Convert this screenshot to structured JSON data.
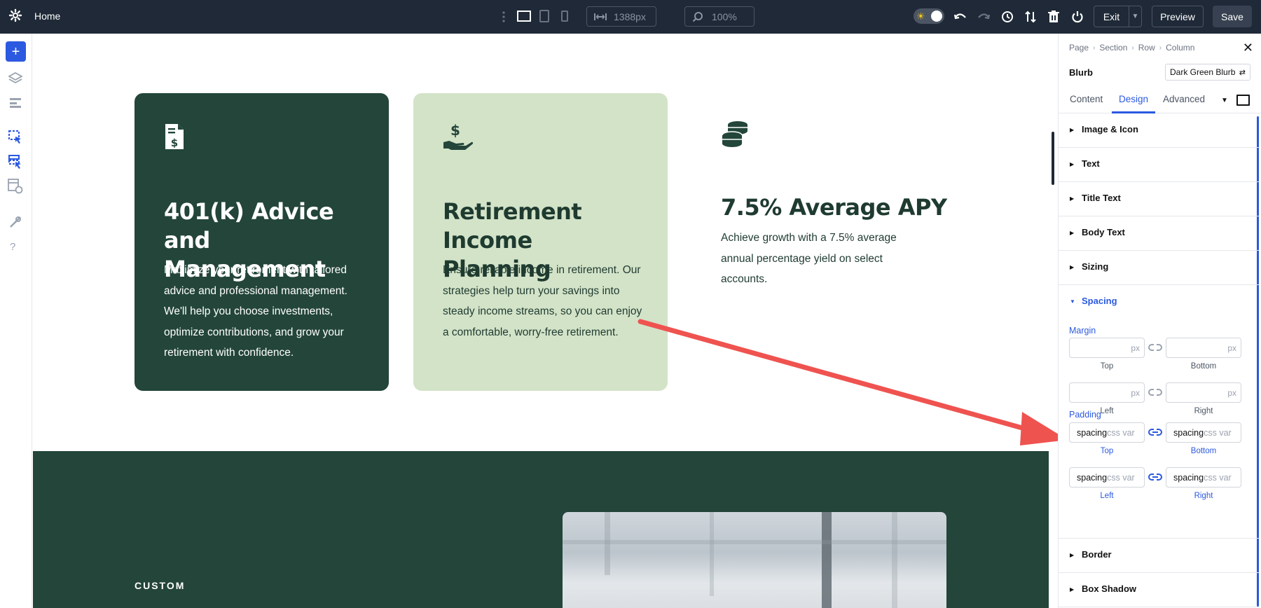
{
  "topbar": {
    "page_title": "Home",
    "width_value": "1388px",
    "zoom_value": "100%",
    "exit_label": "Exit",
    "preview_label": "Preview",
    "save_label": "Save",
    "icons": [
      "gear-icon",
      "drag-dots-icon",
      "desktop-view-icon",
      "tablet-view-icon",
      "phone-view-icon",
      "width-icon",
      "zoom-icon",
      "theme-toggle",
      "undo-icon",
      "redo-icon",
      "history-icon",
      "portability-icon",
      "trash-icon",
      "power-icon",
      "chevron-down-icon"
    ]
  },
  "sidebar": {
    "icons": [
      "add-icon",
      "layers-icon",
      "layout-icon",
      "wireframe-icon",
      "multi-select-icon",
      "page-settings-icon",
      "tools-icon",
      "help-icon"
    ],
    "help_label": "?"
  },
  "canvas": {
    "cards": [
      {
        "icon": "document-dollar-icon",
        "title": "401(k) Advice and Management",
        "body": "Maximize your retirement with tailored advice and professional management. We'll help you choose investments, optimize contributions, and grow your retirement with confidence."
      },
      {
        "icon": "hand-dollar-icon",
        "title": "Retirement Income Planning",
        "body": "Ensure reliable income in retirement. Our strategies help turn your savings into steady income streams, so you can enjoy a comfortable, worry-free retirement."
      },
      {
        "icon": "coins-icon",
        "title": "7.5% Average APY",
        "body": "Achieve growth with a 7.5% average annual percentage yield on select accounts."
      }
    ],
    "band_label": "CUSTOM",
    "colors": {
      "dark_green": "#23453a",
      "light_green": "#d3e3c8",
      "arrow": "#ef5350"
    }
  },
  "panel": {
    "breadcrumbs": [
      "Page",
      "Section",
      "Row",
      "Column"
    ],
    "module_name": "Blurb",
    "preset": "Dark Green Blurb",
    "tabs": [
      "Content",
      "Design",
      "Advanced"
    ],
    "active_tab": "Design",
    "sections_before": [
      "Image & Icon",
      "Text",
      "Title Text",
      "Body Text",
      "Sizing"
    ],
    "open_section": "Spacing",
    "margin": {
      "label": "Margin",
      "unit": "px",
      "top": "Top",
      "bottom": "Bottom",
      "left": "Left",
      "right": "Right"
    },
    "padding": {
      "label": "Padding",
      "value": "spacing",
      "hint": "css var",
      "top": "Top",
      "bottom": "Bottom",
      "left": "Left",
      "right": "Right"
    },
    "sections_after": [
      "Border",
      "Box Shadow"
    ],
    "accent": "#2b59e0"
  }
}
